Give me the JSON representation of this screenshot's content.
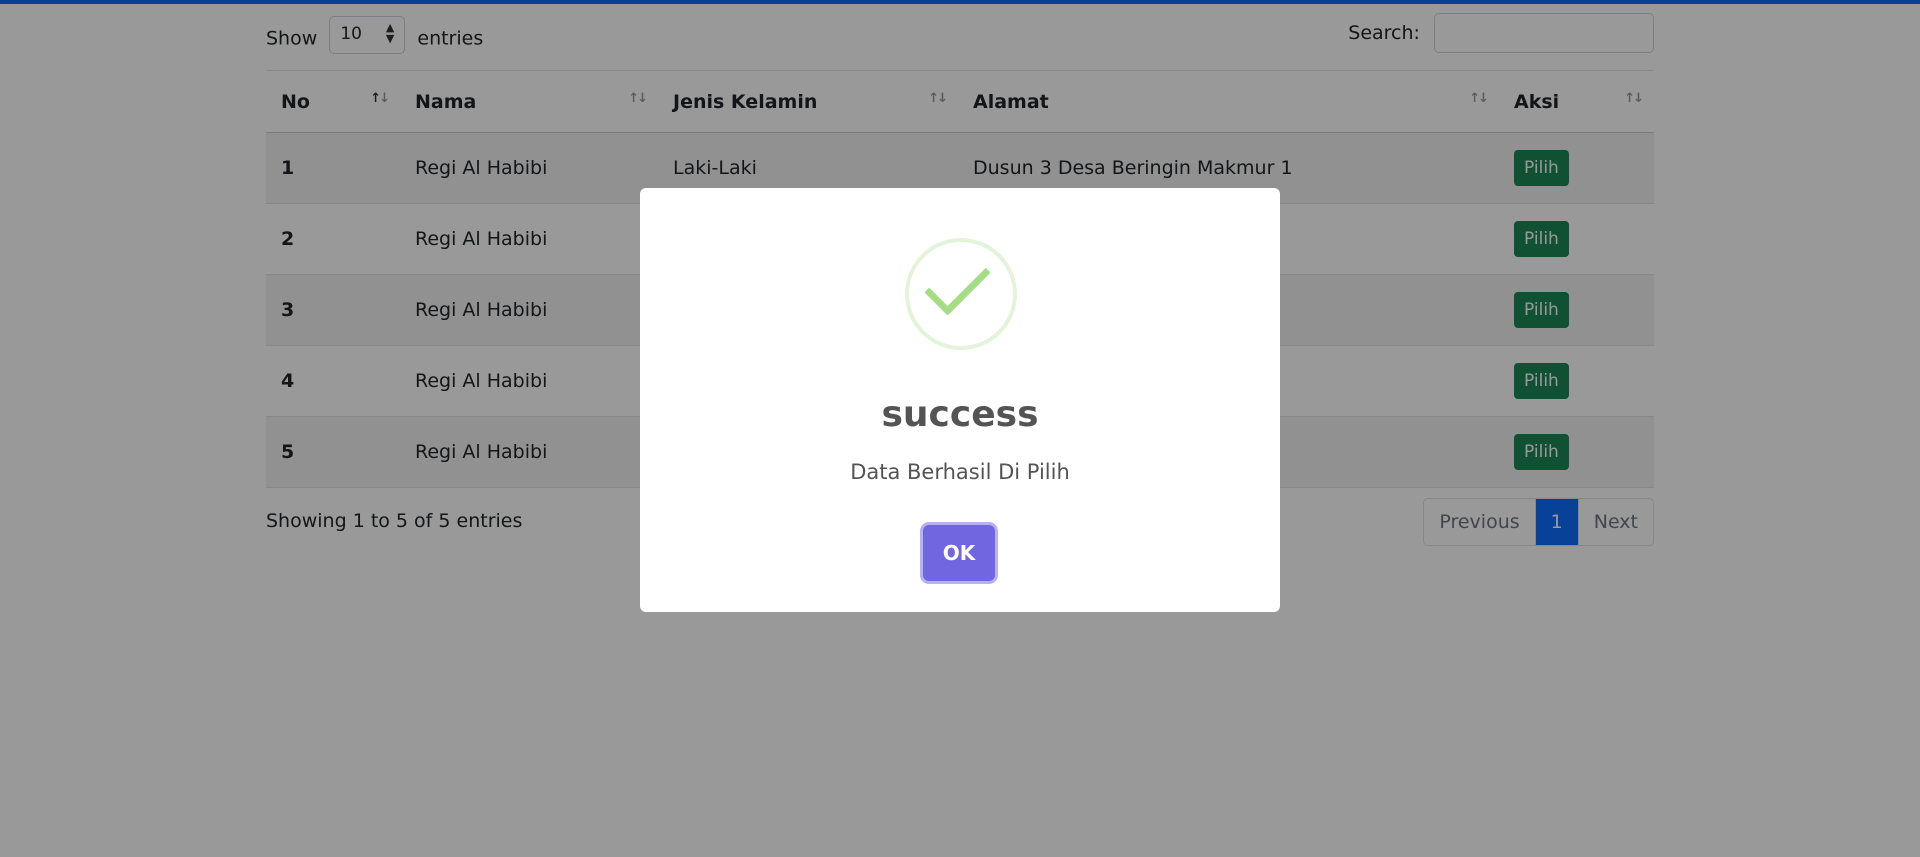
{
  "controls": {
    "show_label": "Show",
    "entries_value": "10",
    "entries_label": "entries",
    "search_label": "Search:"
  },
  "table": {
    "headers": [
      "No",
      "Nama",
      "Jenis Kelamin",
      "Alamat",
      "Aksi"
    ],
    "rows": [
      {
        "no": "1",
        "nama": "Regi Al Habibi",
        "jk": "Laki-Laki",
        "alamat": "Dusun 3 Desa Beringin Makmur 1",
        "aksi": "Pilih"
      },
      {
        "no": "2",
        "nama": "Regi Al Habibi",
        "jk": "",
        "alamat": "",
        "aksi": "Pilih"
      },
      {
        "no": "3",
        "nama": "Regi Al Habibi",
        "jk": "",
        "alamat": "",
        "aksi": "Pilih"
      },
      {
        "no": "4",
        "nama": "Regi Al Habibi",
        "jk": "",
        "alamat": "",
        "aksi": "Pilih"
      },
      {
        "no": "5",
        "nama": "Regi Al Habibi",
        "jk": "",
        "alamat": "",
        "aksi": "Pilih"
      }
    ]
  },
  "footer": {
    "info": "Showing 1 to 5 of 5 entries",
    "previous": "Previous",
    "page": "1",
    "next": "Next"
  },
  "modal": {
    "icon": "success-check-icon",
    "title": "success",
    "text": "Data Berhasil Di Pilih",
    "ok_label": "OK",
    "accent_color": "#7066e0",
    "icon_color": "#a5dc86"
  }
}
